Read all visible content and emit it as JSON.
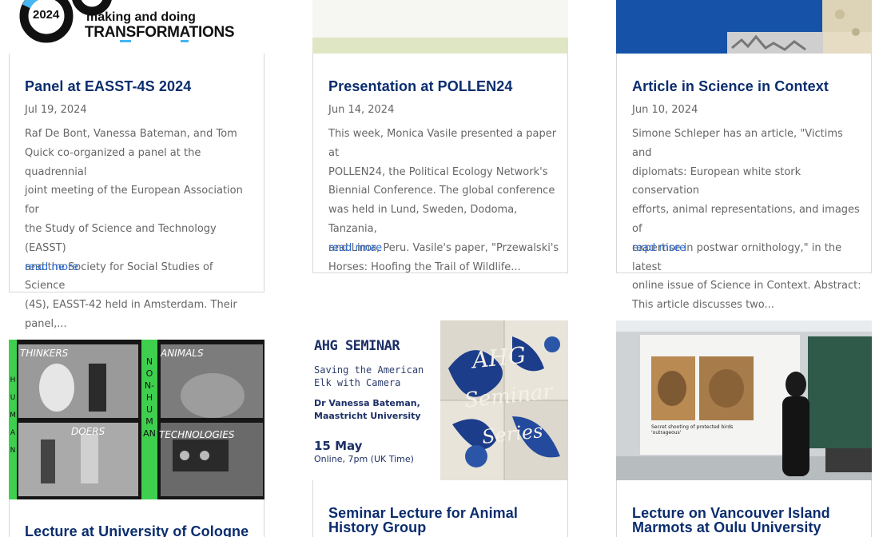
{
  "posts": [
    {
      "title": "Panel at EASST-4S 2024",
      "date": "Jul 19, 2024",
      "excerpt_lines": [
        "Raf De Bont, Vanessa Bateman, and Tom",
        "Quick co-organized a panel at the quadrennial",
        "joint meeting of the European Association for",
        "the Study of Science and Technology (EASST)",
        "and the Society for Social Studies of Science",
        "(4S), EASST-42 held in Amsterdam. Their",
        "panel,..."
      ],
      "read_more": "read more",
      "thumb_text": {
        "badge": "2024",
        "line1": "making and doing",
        "line2": "TRANSFORMATIONS"
      }
    },
    {
      "title": "Presentation at POLLEN24",
      "date": "Jun 14, 2024",
      "excerpt_lines": [
        "This week, Monica Vasile presented a paper at",
        "POLLEN24, the Political Ecology Network's",
        "Biennial Conference. The global conference",
        "was held in Lund, Sweden, Dodoma, Tanzania,",
        "and Lima, Peru. Vasile's paper, \"Przewalski's",
        "Horses: Hoofing the Trail of Wildlife..."
      ],
      "read_more": "read more"
    },
    {
      "title": "Article in Science in Context",
      "date": "Jun 10, 2024",
      "excerpt_lines": [
        "Simone Schleper has an article, \"Victims and",
        "diplomats: European white stork conservation",
        "efforts, animal representations, and images of",
        "expertise in postwar ornithology,\" in the latest",
        "online issue of Science in Context. Abstract:",
        "This article discusses two..."
      ],
      "read_more": "read more"
    },
    {
      "title": "Lecture at University of Cologne",
      "thumb_text": {
        "thinkers": "THINKERS",
        "animals": "ANIMALS",
        "doers": "DOERS",
        "technologies": "TECHNOLOGIES",
        "vertical": "NON-HUMAN",
        "left_vertical": "HUMAN"
      }
    },
    {
      "title_lines": [
        "Seminar Lecture for Animal",
        "History Group"
      ],
      "thumb_text": {
        "heading": "AHG SEMINAR",
        "subtitle1": "Saving the American",
        "subtitle2": "Elk with Camera",
        "speaker1": "Dr Vanessa Bateman,",
        "speaker2": "Maastricht University",
        "date": "15 May",
        "time": "Online, 7pm (UK Time)",
        "script1": "AHG",
        "script2": "Seminar",
        "script3": "Series"
      }
    },
    {
      "title_lines": [
        "Lecture on Vancouver Island",
        "Marmots at Oulu University"
      ],
      "thumb_text": {
        "slide_caption": "Secret shooting of protected birds 'outrageous'"
      }
    }
  ],
  "colors": {
    "title": "#0b2d6e",
    "link": "#2b6bd6",
    "text": "#666666",
    "border": "#d8d8d8"
  }
}
